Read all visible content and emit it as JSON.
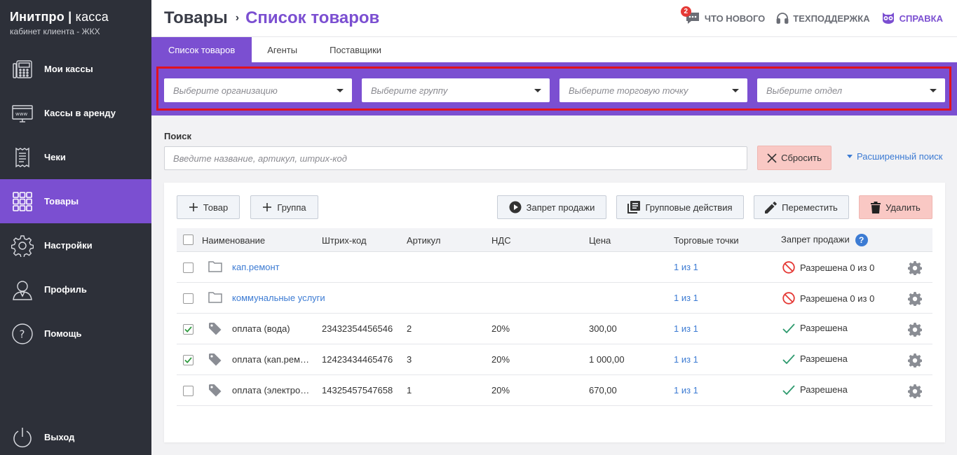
{
  "brand": {
    "name_bold": "Инитпро",
    "separator": "|",
    "name_light": "касса",
    "subtitle": "кабинет клиента - ЖКХ"
  },
  "sidebar": {
    "items": [
      {
        "label": "Мои кассы",
        "icon": "cash-register-icon"
      },
      {
        "label": "Кассы в аренду",
        "icon": "www-monitor-icon"
      },
      {
        "label": "Чеки",
        "icon": "receipt-icon"
      },
      {
        "label": "Товары",
        "icon": "grid-icon",
        "active": true
      },
      {
        "label": "Настройки",
        "icon": "gear-icon"
      },
      {
        "label": "Профиль",
        "icon": "user-icon"
      },
      {
        "label": "Помощь",
        "icon": "question-icon"
      }
    ],
    "logout": {
      "label": "Выход",
      "icon": "power-icon"
    }
  },
  "header": {
    "breadcrumb_root": "Товары",
    "breadcrumb_sep": "›",
    "breadcrumb_current": "Список товаров",
    "whats_new": {
      "label": "ЧТО НОВОГО",
      "badge": "2"
    },
    "support": {
      "label": "ТЕХПОДДЕРЖКА"
    },
    "help": {
      "label": "СПРАВКА"
    }
  },
  "tabs": [
    {
      "label": "Список товаров",
      "active": true
    },
    {
      "label": "Агенты"
    },
    {
      "label": "Поставщики"
    }
  ],
  "filters": {
    "organization_placeholder": "Выберите организацию",
    "group_placeholder": "Выберите группу",
    "point_placeholder": "Выберите торговую точку",
    "department_placeholder": "Выберите отдел"
  },
  "search": {
    "label": "Поиск",
    "placeholder": "Введите название, артикул, штрих-код",
    "reset_label": "Сбросить",
    "advanced_label": "Расширенный поиск"
  },
  "toolbar": {
    "add_product": "Товар",
    "add_group": "Группа",
    "ban_sale": "Запрет продажи",
    "group_actions": "Групповые действия",
    "move": "Переместить",
    "delete": "Удалить"
  },
  "table": {
    "columns": {
      "name": "Наименование",
      "barcode": "Штрих-код",
      "article": "Артикул",
      "vat": "НДС",
      "price": "Цена",
      "points": "Торговые точки",
      "sale_ban": "Запрет продажи",
      "help": "?"
    },
    "rows": [
      {
        "type": "folder",
        "checked": false,
        "name": "кап.ремонт",
        "barcode": "",
        "article": "",
        "vat": "",
        "price": "",
        "points": "1 из 1",
        "status": "Разрешена 0 из 0",
        "status_kind": "banned"
      },
      {
        "type": "folder",
        "checked": false,
        "name": "коммунальные услуги",
        "barcode": "",
        "article": "",
        "vat": "",
        "price": "",
        "points": "1 из 1",
        "status": "Разрешена 0 из 0",
        "status_kind": "banned"
      },
      {
        "type": "product",
        "checked": true,
        "name": "оплата (вода)",
        "barcode": "23432354456546",
        "article": "2",
        "vat": "20%",
        "price": "300,00",
        "points": "1 из 1",
        "status": "Разрешена",
        "status_kind": "ok"
      },
      {
        "type": "product",
        "checked": true,
        "name": "оплата (кап.рем…",
        "barcode": "12423434465476",
        "article": "3",
        "vat": "20%",
        "price": "1 000,00",
        "points": "1 из 1",
        "status": "Разрешена",
        "status_kind": "ok"
      },
      {
        "type": "product",
        "checked": false,
        "name": "оплата (электро…",
        "barcode": "14325457547658",
        "article": "1",
        "vat": "20%",
        "price": "670,00",
        "points": "1 из 1",
        "status": "Разрешена",
        "status_kind": "ok"
      }
    ]
  },
  "colors": {
    "accent": "#7b4fd1",
    "sidebar": "#2d3039",
    "link": "#3c7bd3",
    "danger_bg": "#f9c8c4",
    "highlight_frame": "#e0121e"
  }
}
